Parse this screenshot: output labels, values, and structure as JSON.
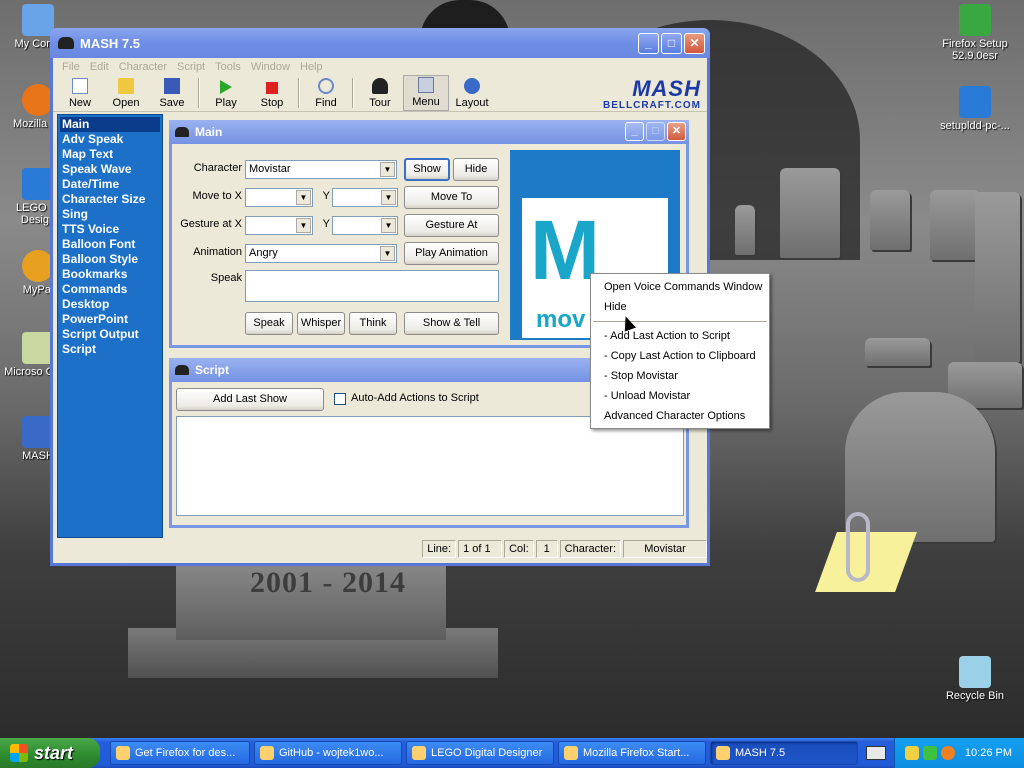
{
  "desktop": {
    "icons_left": [
      {
        "label": "My Comp",
        "color": "#6aa4e8"
      },
      {
        "label": "Mozilla Fir",
        "color": "#e8741a"
      },
      {
        "label": "LEGO Di Design",
        "color": "#2a7ad8"
      },
      {
        "label": "MyPal",
        "color": "#e8a020"
      },
      {
        "label": "Microso Outlo",
        "color": "#c8d8a0"
      },
      {
        "label": "MASH",
        "color": "#3a6ac8"
      }
    ],
    "icons_right": [
      {
        "label": "Firefox Setup 52.9.0esr",
        "color": "#3aa840"
      },
      {
        "label": "setupldd-pc-...",
        "color": "#2a7ad8"
      },
      {
        "label": "Recycle Bin",
        "color": "#9ad0e8"
      }
    ],
    "stone_text": "2001 - 2014"
  },
  "window": {
    "title": "MASH 7.5",
    "menu": [
      "File",
      "Edit",
      "Character",
      "Script",
      "Tools",
      "Window",
      "Help"
    ],
    "toolbar": [
      {
        "label": "New",
        "icon": "new-icon"
      },
      {
        "label": "Open",
        "icon": "open-icon"
      },
      {
        "label": "Save",
        "icon": "save-icon"
      },
      {
        "label": "Play",
        "icon": "play-icon"
      },
      {
        "label": "Stop",
        "icon": "stop-icon"
      },
      {
        "label": "Find",
        "icon": "find-icon"
      },
      {
        "label": "Tour",
        "icon": "tour-icon"
      },
      {
        "label": "Menu",
        "icon": "menu-icon"
      },
      {
        "label": "Layout",
        "icon": "layout-icon"
      }
    ],
    "logo_main": "MASH",
    "logo_sub": "BELLCRAFT.COM",
    "sidebar": [
      "Main",
      "Adv Speak",
      "Map Text",
      "Speak Wave",
      "Date/Time",
      "Character Size",
      "Sing",
      "TTS Voice",
      "Balloon Font",
      "Balloon Style",
      "Bookmarks",
      "Commands",
      "Desktop",
      "PowerPoint",
      "Script Output",
      "Script"
    ],
    "status": {
      "line_label": "Line:",
      "line_value": "1 of 1",
      "col_label": "Col:",
      "col_value": "1",
      "char_label": "Character:",
      "char_value": "Movistar"
    }
  },
  "main_panel": {
    "title": "Main",
    "character_label": "Character",
    "character_value": "Movistar",
    "show_button": "Show",
    "hide_button": "Hide",
    "move_to_x_label": "Move to X",
    "y_label": "Y",
    "move_to_button": "Move To",
    "gesture_at_x_label": "Gesture at X",
    "gesture_at_button": "Gesture At",
    "animation_label": "Animation",
    "animation_value": "Angry",
    "play_animation_button": "Play Animation",
    "speak_label": "Speak",
    "speak_button": "Speak",
    "whisper_button": "Whisper",
    "think_button": "Think",
    "show_tell_button": "Show & Tell",
    "preview_text": "mov"
  },
  "script_panel": {
    "title": "Script",
    "add_last_show_button": "Add Last Show",
    "auto_add_label": "Auto-Add Actions to Script"
  },
  "context_menu": {
    "items_top": [
      "Open Voice Commands Window",
      "Hide"
    ],
    "items_bottom": [
      "- Add Last Action to Script",
      "- Copy Last Action to Clipboard",
      "- Stop Movistar",
      "- Unload Movistar",
      "Advanced Character Options"
    ]
  },
  "taskbar": {
    "start_label": "start",
    "tasks": [
      {
        "label": "Get Firefox for des..."
      },
      {
        "label": "GitHub - wojtek1wo..."
      },
      {
        "label": "LEGO Digital Designer"
      },
      {
        "label": "Mozilla Firefox Start..."
      },
      {
        "label": "MASH 7.5"
      }
    ],
    "clock": "10:26 PM"
  }
}
